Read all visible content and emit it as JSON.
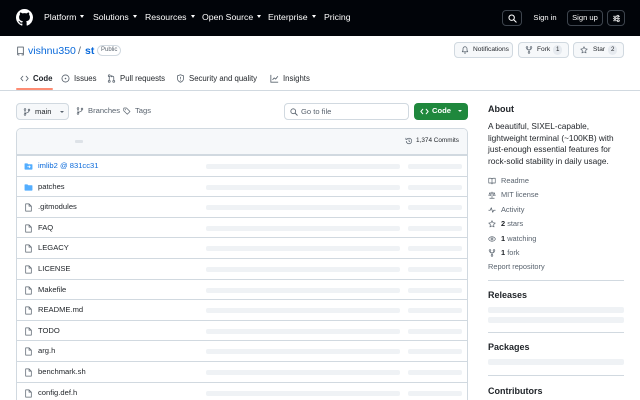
{
  "header": {
    "nav": [
      {
        "label": "Platform"
      },
      {
        "label": "Solutions"
      },
      {
        "label": "Resources"
      },
      {
        "label": "Open Source"
      },
      {
        "label": "Enterprise"
      },
      {
        "label": "Pricing"
      }
    ],
    "sign_in": "Sign in",
    "sign_up": "Sign up"
  },
  "repo": {
    "owner": "vishnu350",
    "separator": "/",
    "name": "st",
    "visibility": "Public",
    "notifications_label": "Notifications",
    "fork_label": "Fork",
    "fork_count": "1",
    "star_label": "Star",
    "star_count": "2"
  },
  "tabs": [
    {
      "label": "Code",
      "active": true
    },
    {
      "label": "Issues"
    },
    {
      "label": "Pull requests"
    },
    {
      "label": "Security and quality"
    },
    {
      "label": "Insights"
    }
  ],
  "controls": {
    "branch": "main",
    "branches_label": "Branches",
    "tags_label": "Tags",
    "search_placeholder": "Go to file",
    "code_button": "Code"
  },
  "files": {
    "commits": "1,374 Commits",
    "rows": [
      {
        "name": "imlib2 @ 831cc31",
        "type": "submodule"
      },
      {
        "name": "patches",
        "type": "dir"
      },
      {
        "name": ".gitmodules",
        "type": "file"
      },
      {
        "name": "FAQ",
        "type": "file"
      },
      {
        "name": "LEGACY",
        "type": "file"
      },
      {
        "name": "LICENSE",
        "type": "file"
      },
      {
        "name": "Makefile",
        "type": "file"
      },
      {
        "name": "README.md",
        "type": "file"
      },
      {
        "name": "TODO",
        "type": "file"
      },
      {
        "name": "arg.h",
        "type": "file"
      },
      {
        "name": "benchmark.sh",
        "type": "file"
      },
      {
        "name": "config.def.h",
        "type": "file"
      }
    ]
  },
  "sidebar": {
    "about_title": "About",
    "description": "A beautiful, SIXEL-capable, lightweight terminal (~100KB) with just-enough essential features for rock-solid stability in daily usage.",
    "links": [
      {
        "icon": "book-icon",
        "label": "Readme"
      },
      {
        "icon": "law-icon",
        "label": "MIT license"
      },
      {
        "icon": "pulse-icon",
        "label": "Activity"
      }
    ],
    "stats": [
      {
        "icon": "star-icon",
        "count": "2",
        "label": "stars"
      },
      {
        "icon": "eye-icon",
        "count": "1",
        "label": "watching"
      },
      {
        "icon": "fork-icon",
        "count": "1",
        "label": "fork"
      }
    ],
    "report": "Report repository",
    "releases_title": "Releases",
    "packages_title": "Packages",
    "contributors_title": "Contributors"
  },
  "colors": {
    "header_bg": "#010409",
    "link": "#0969da",
    "code_button": "#1f883d",
    "active_tab": "#fd8c73"
  }
}
